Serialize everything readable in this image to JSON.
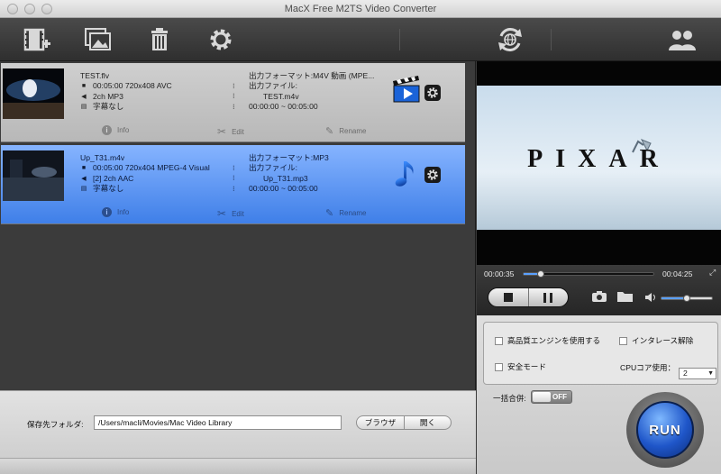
{
  "window": {
    "title": "MacX Free M2TS Video Converter"
  },
  "toolbar": {
    "add_video_icon": "film-plus-icon",
    "add_image_icon": "photo-icon",
    "delete_icon": "trash-icon",
    "settings_icon": "gear-icon",
    "update_icon": "globe-refresh-icon",
    "account_icon": "users-icon"
  },
  "files": [
    {
      "name": "TEST.flv",
      "duration_info": "00:05:00 720x408 AVC",
      "audio": "2ch MP3",
      "subtitle": "字幕なし",
      "output_format": "出力フォーマット:M4V 動画 (MPE...",
      "output_file_label": "出力ファイル:",
      "output_file": "TEST.m4v",
      "range": "00:00:00 ~ 00:05:00",
      "type_icon": "video-clapper-icon"
    },
    {
      "name": "Up_T31.m4v",
      "duration_info": "00:05:00 720x404 MPEG-4 Visual",
      "audio": "[2] 2ch AAC",
      "subtitle": "字幕なし",
      "output_format": "出力フォーマット:MP3",
      "output_file_label": "出力ファイル:",
      "output_file": "Up_T31.mp3",
      "range": "00:00:00 ~ 00:05:00",
      "type_icon": "music-note-icon"
    }
  ],
  "item_actions": {
    "info": "Info",
    "edit": "Edit",
    "rename": "Rename"
  },
  "output": {
    "folder_label": "保存先フォルダ:",
    "folder_path": "/Users/macli/Movies/Mac Video Library",
    "browse_label": "ブラウザ",
    "open_label": "開く"
  },
  "preview": {
    "logo_text": "PIXAR",
    "time_current": "00:00:35",
    "time_total": "00:04:25",
    "progress": 0.13,
    "volume": 0.5
  },
  "settings": {
    "hq_engine_label": "高品質エンジンを使用する",
    "deinterlace_label": "インタレース解除",
    "safe_mode_label": "安全モード",
    "cpu_label": "CPUコア使用：",
    "cpu_value": "2",
    "merge_label": "一括合併:",
    "merge_state": "OFF",
    "run_label": "RUN"
  }
}
